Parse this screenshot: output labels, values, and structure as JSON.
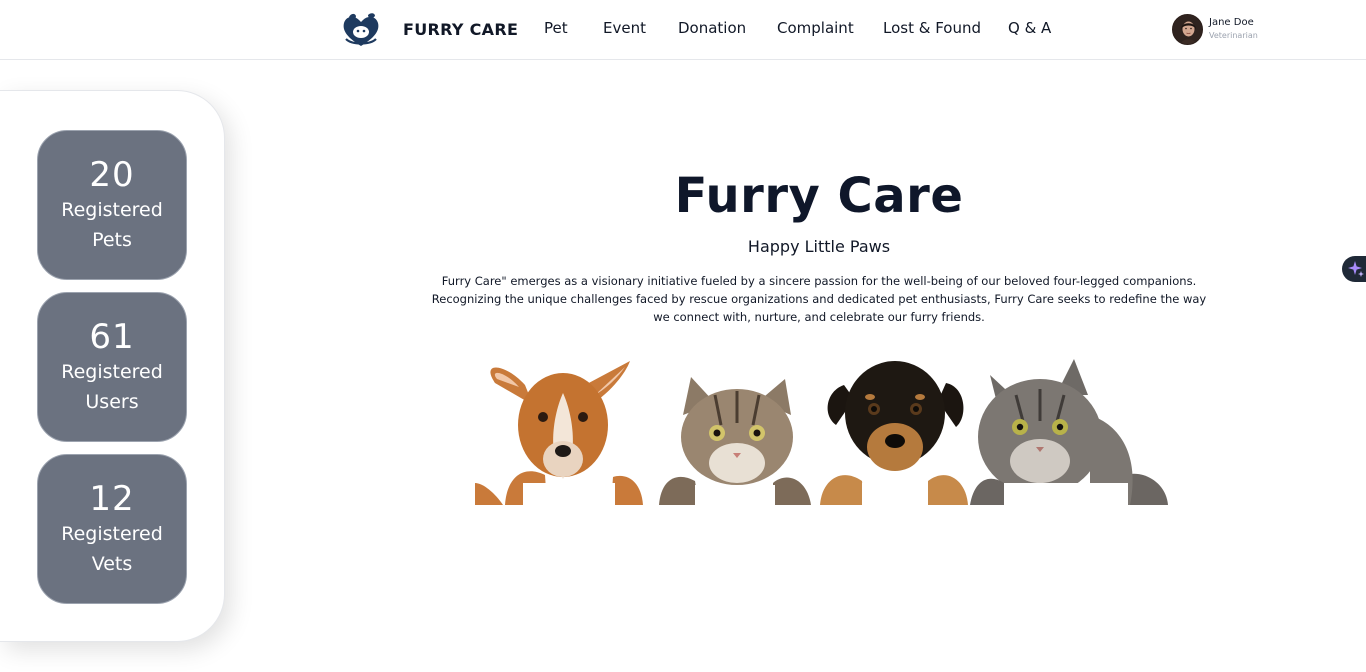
{
  "header": {
    "brand_name": "FURRY CARE",
    "logo_icon": "pet-heart-logo-icon",
    "nav": [
      {
        "label": "Pet"
      },
      {
        "label": "Event"
      },
      {
        "label": "Donation"
      },
      {
        "label": "Complaint"
      },
      {
        "label": "Lost & Found"
      },
      {
        "label": "Q & A"
      }
    ],
    "user": {
      "name": "Jane Doe",
      "role": "Veterinarian",
      "avatar_icon": "user-avatar-icon"
    }
  },
  "stats": [
    {
      "number": "20",
      "label": "Registered Pets"
    },
    {
      "number": "61",
      "label": "Registered Users"
    },
    {
      "number": "12",
      "label": "Registered Vets"
    }
  ],
  "hero": {
    "title": "Furry Care",
    "subtitle": "Happy Little Paws",
    "description": "Furry Care\" emerges as a visionary initiative fueled by a sincere passion for the well-being of our beloved four-legged companions. Recognizing the unique challenges faced by rescue organizations and dedicated pet enthusiasts, Furry Care seeks to redefine the way we connect with, nurture, and celebrate our furry friends.",
    "pets_image": [
      "tan-dog",
      "tabby-cat",
      "black-tan-puppy",
      "grey-tabby-cat"
    ]
  },
  "widget": {
    "icon": "sparkle-icon"
  },
  "colors": {
    "stat_card_bg": "#6b7280",
    "text_dark": "#111827",
    "border": "#e5e7eb",
    "widget_bg": "#1f2937",
    "sparkle": "#a78bfa"
  }
}
